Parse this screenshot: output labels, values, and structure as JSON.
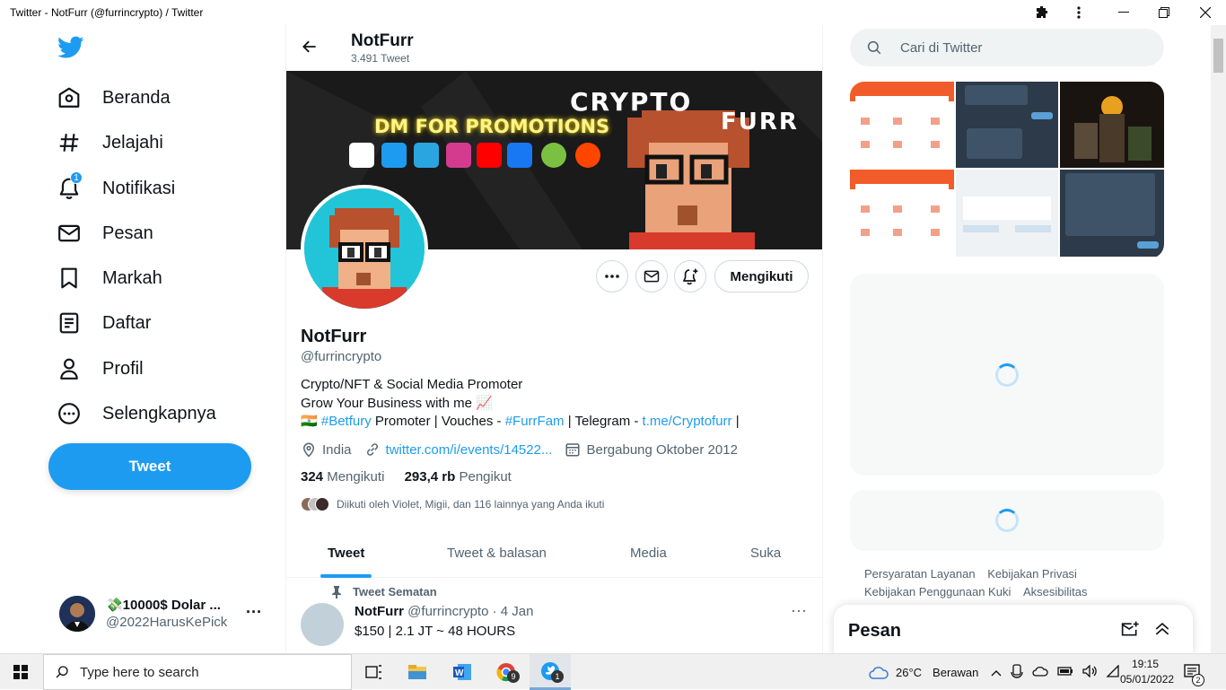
{
  "window": {
    "title": "Twitter - NotFurr (@furrincrypto) / Twitter"
  },
  "nav": {
    "items": [
      {
        "label": "Beranda"
      },
      {
        "label": "Jelajahi"
      },
      {
        "label": "Notifikasi",
        "badge": "1"
      },
      {
        "label": "Pesan"
      },
      {
        "label": "Markah"
      },
      {
        "label": "Daftar"
      },
      {
        "label": "Profil"
      },
      {
        "label": "Selengkapnya"
      }
    ],
    "tweet_button": "Tweet"
  },
  "account": {
    "name": "💸10000$ Dolar ...",
    "handle": "@2022HarusKePick"
  },
  "profile_header": {
    "name": "NotFurr",
    "tweet_count": "3.491 Tweet"
  },
  "banner": {
    "title_line1": "CRYPTO",
    "title_line2": "FURR",
    "promo": "DM FOR PROMOTIONS"
  },
  "profile": {
    "name": "NotFurr",
    "handle": "@furrincrypto",
    "follow_button": "Mengikuti",
    "bio_line1": "Crypto/NFT & Social Media Promoter",
    "bio_line2": "Grow Your Business with me 📈",
    "bio_line3_flag": "🇮🇳",
    "bio_hashtag1": "#Betfury",
    "bio_text_a": " Promoter | Vouches - ",
    "bio_hashtag2": "#FurrFam",
    "bio_text_b": " | Telegram - ",
    "bio_link": "t.me/Cryptofurr",
    "bio_text_c": " |",
    "location": "India",
    "website": "twitter.com/i/events/14522...",
    "joined": "Bergabung Oktober 2012",
    "following_count": "324",
    "following_label": "Mengikuti",
    "followers_count": "293,4 rb",
    "followers_label": "Pengikut",
    "followed_by": "Diikuti oleh Violet, Migii, dan 116 lainnya yang Anda ikuti"
  },
  "tabs": [
    {
      "label": "Tweet",
      "active": true
    },
    {
      "label": "Tweet & balasan"
    },
    {
      "label": "Media"
    },
    {
      "label": "Suka"
    }
  ],
  "pinned_tweet": {
    "pinned_label": "Tweet Sematan",
    "name": "NotFurr",
    "handle_date": "@furrincrypto · 4 Jan",
    "text": "$150 | 2.1 JT ~ 48 HOURS"
  },
  "search": {
    "placeholder": "Cari di Twitter"
  },
  "footer_links": {
    "line1a": "Persyaratan Layanan",
    "line1b": "Kebijakan Privasi",
    "line2a": "Kebijakan Penggunaan Kuki",
    "line2b": "Aksesibilitas"
  },
  "messages": {
    "title": "Pesan"
  },
  "taskbar": {
    "search_placeholder": "Type here to search",
    "weather_temp": "26°C",
    "weather_text": "Berawan",
    "time": "19:15",
    "date": "05/01/2022",
    "notification_count": "2",
    "chrome_badge": "9",
    "twitter_badge": "1"
  },
  "colors": {
    "accent": "#1d9bf0",
    "text": "#0f1419",
    "secondary": "#536471"
  }
}
